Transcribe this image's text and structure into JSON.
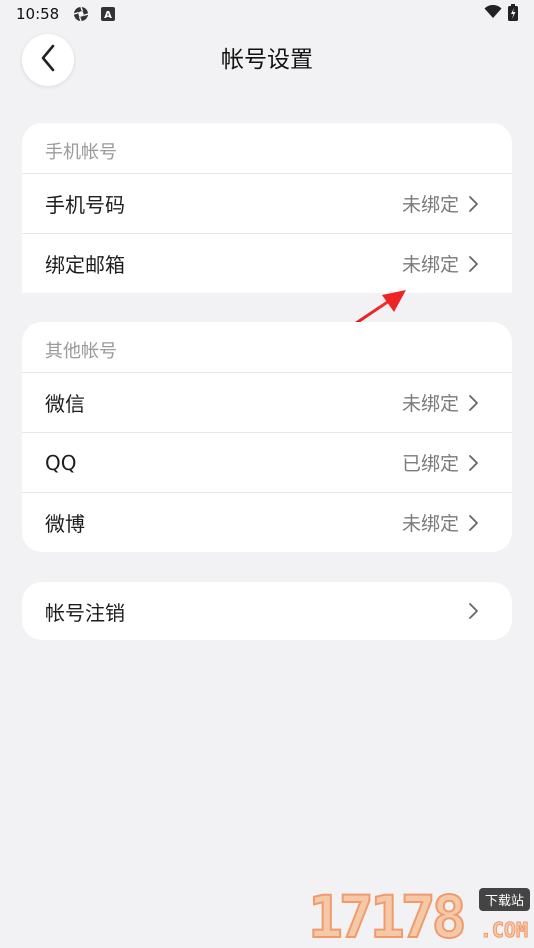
{
  "status_bar": {
    "time": "10:58",
    "a_badge": "A"
  },
  "header": {
    "title": "帐号设置"
  },
  "phone_section": {
    "header": "手机帐号",
    "rows": [
      {
        "label": "手机号码",
        "value": "未绑定"
      },
      {
        "label": "绑定邮箱",
        "value": "未绑定"
      }
    ]
  },
  "other_section": {
    "header": "其他帐号",
    "rows": [
      {
        "label": "微信",
        "value": "未绑定"
      },
      {
        "label": "QQ",
        "value": "已绑定"
      },
      {
        "label": "微博",
        "value": "未绑定"
      }
    ]
  },
  "cancel_section": {
    "label": "帐号注销"
  },
  "watermark": {
    "digits": "17178",
    "badge": "下载站",
    "suffix": ".COM"
  },
  "colors": {
    "background": "#f2f2f4",
    "card": "#ffffff",
    "annotation_arrow": "#e02020"
  }
}
